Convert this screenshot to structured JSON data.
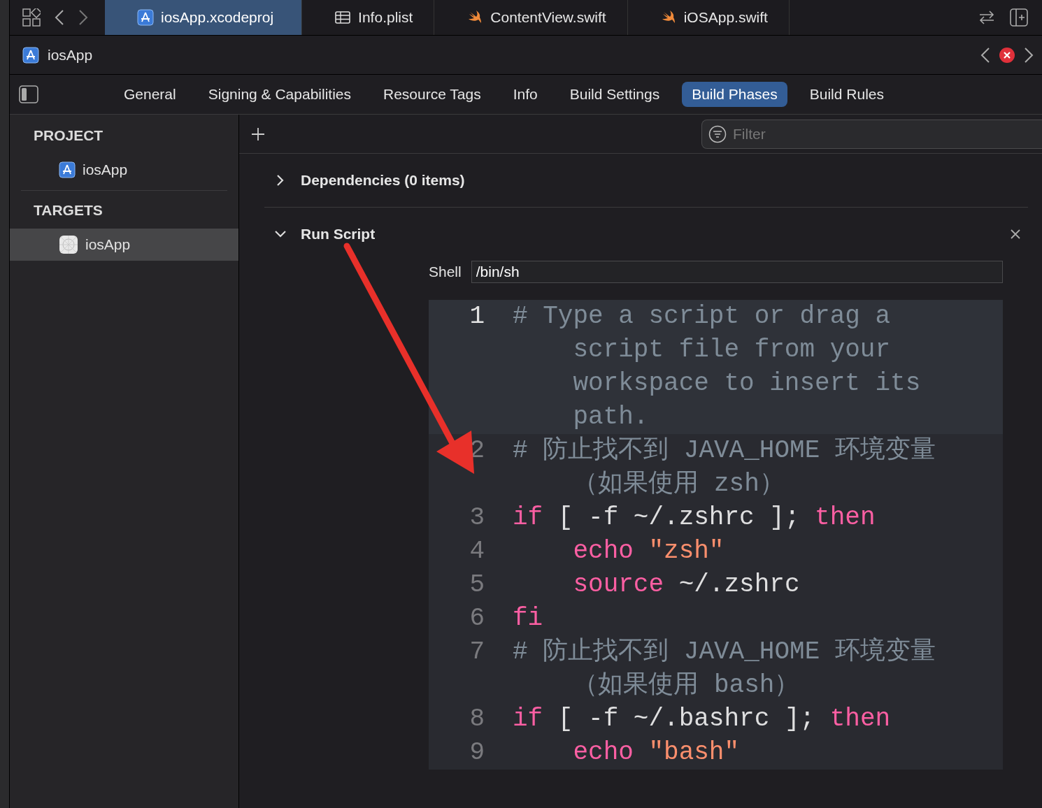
{
  "tabs": [
    {
      "label": "iosApp.xcodeproj",
      "kind": "project",
      "selected": true
    },
    {
      "label": "Info.plist",
      "kind": "plist",
      "selected": false
    },
    {
      "label": "ContentView.swift",
      "kind": "swift",
      "selected": false
    },
    {
      "label": "iOSApp.swift",
      "kind": "swift",
      "selected": false
    }
  ],
  "breadcrumb": {
    "label": "iosApp",
    "has_error": true
  },
  "editor_tabs": [
    {
      "label": "General",
      "selected": false
    },
    {
      "label": "Signing & Capabilities",
      "selected": false
    },
    {
      "label": "Resource Tags",
      "selected": false
    },
    {
      "label": "Info",
      "selected": false
    },
    {
      "label": "Build Settings",
      "selected": false
    },
    {
      "label": "Build Phases",
      "selected": true
    },
    {
      "label": "Build Rules",
      "selected": false
    }
  ],
  "sidebar": {
    "sections": [
      {
        "heading": "PROJECT",
        "items": [
          {
            "label": "iosApp",
            "kind": "project",
            "selected": false
          }
        ]
      },
      {
        "heading": "TARGETS",
        "items": [
          {
            "label": "iosApp",
            "kind": "app",
            "selected": true
          }
        ]
      }
    ]
  },
  "filter": {
    "placeholder": "Filter"
  },
  "phases": [
    {
      "title": "Dependencies (0 items)",
      "expanded": false
    },
    {
      "title": "Run Script",
      "expanded": true,
      "shell_label": "Shell",
      "shell": "/bin/sh",
      "lines": [
        {
          "number": "1",
          "current": true,
          "tokens": [
            {
              "kind": "comment",
              "text": "# Type a script or drag a script file from your workspace to insert its path."
            }
          ]
        },
        {
          "number": "2",
          "current": false,
          "tokens": [
            {
              "kind": "comment",
              "text": "# 防止找不到 JAVA_HOME 环境变量（如果使用 zsh）"
            }
          ]
        },
        {
          "number": "3",
          "current": false,
          "tokens": [
            {
              "kind": "keyword",
              "text": "if"
            },
            {
              "kind": "plain",
              "text": " [ -f ~/.zshrc ]; "
            },
            {
              "kind": "keyword",
              "text": "then"
            }
          ]
        },
        {
          "number": "4",
          "current": false,
          "tokens": [
            {
              "kind": "keyword",
              "text": "    echo"
            },
            {
              "kind": "string",
              "text": " \"zsh\""
            }
          ]
        },
        {
          "number": "5",
          "current": false,
          "tokens": [
            {
              "kind": "keyword",
              "text": "    source"
            },
            {
              "kind": "plain",
              "text": " ~/.zshrc"
            }
          ]
        },
        {
          "number": "6",
          "current": false,
          "tokens": [
            {
              "kind": "keyword",
              "text": "fi"
            }
          ]
        },
        {
          "number": "7",
          "current": false,
          "tokens": [
            {
              "kind": "comment",
              "text": "# 防止找不到 JAVA_HOME 环境变量（如果使用 bash）"
            }
          ]
        },
        {
          "number": "8",
          "current": false,
          "tokens": [
            {
              "kind": "keyword",
              "text": "if"
            },
            {
              "kind": "plain",
              "text": " [ -f ~/.bashrc ]; "
            },
            {
              "kind": "keyword",
              "text": "then"
            }
          ]
        },
        {
          "number": "9",
          "current": false,
          "tokens": [
            {
              "kind": "keyword",
              "text": "    echo"
            },
            {
              "kind": "string",
              "text": " \"bash\""
            }
          ]
        }
      ]
    }
  ]
}
